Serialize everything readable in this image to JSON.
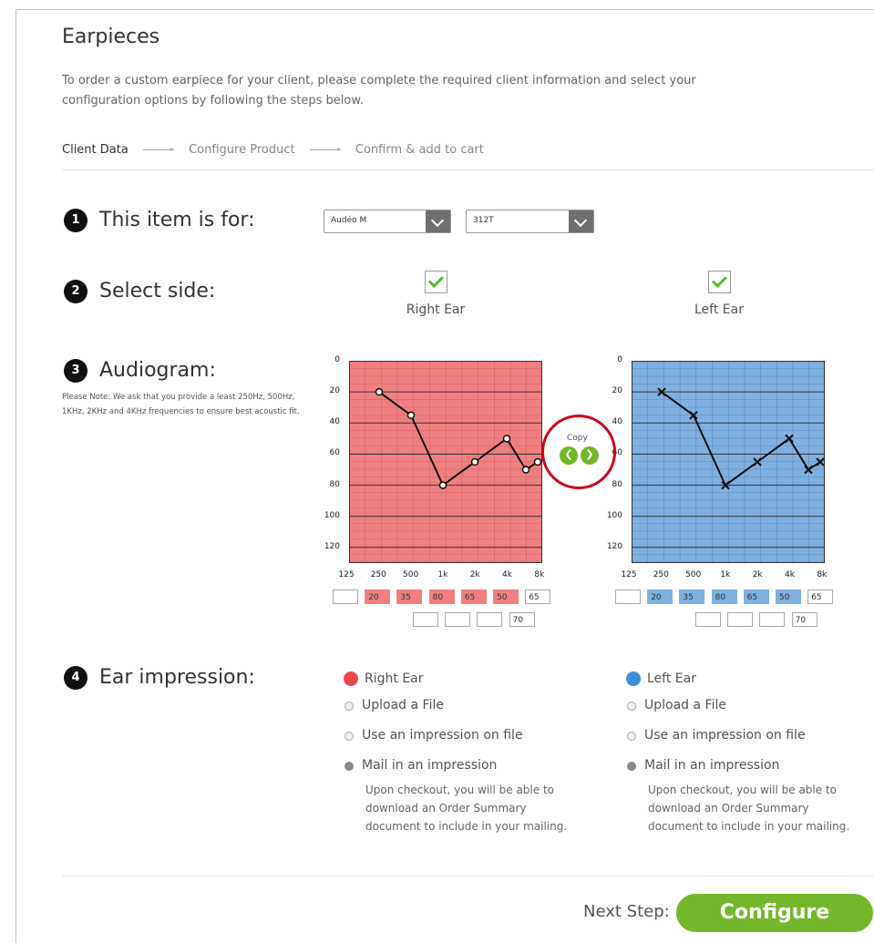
{
  "page": {
    "title": "Earpieces",
    "intro": "To order a custom earpiece for your client, please complete the required client information and select your configuration options by following the steps below."
  },
  "steps": [
    "Client Data",
    "Configure Product",
    "Confirm & add to cart"
  ],
  "section1": {
    "number": "1",
    "label": "This item is for:",
    "dropdown1": "Audéo M",
    "dropdown2": "312T"
  },
  "section2": {
    "number": "2",
    "label": "Select side:",
    "right_label": "Right Ear",
    "left_label": "Left Ear",
    "right_checked": true,
    "left_checked": true
  },
  "section3": {
    "number": "3",
    "label": "Audiogram:",
    "note": "Please Note: We ask that you provide a least 250Hz, 500Hz, 1KHz, 2KHz and 4KHz frequencies to ensure best acoustic fit.",
    "copy_label": "Copy",
    "copy_left_icon": "chevron-left-icon",
    "copy_right_icon": "chevron-right-icon"
  },
  "chart_data": [
    {
      "type": "line",
      "ear": "Right Ear",
      "color": "#f08080",
      "marker": "circle",
      "x": [
        "125",
        "250",
        "500",
        "1k",
        "2k",
        "4k",
        "8k"
      ],
      "y_ticks": [
        "0",
        "20",
        "40",
        "60",
        "80",
        "100",
        "120"
      ],
      "ylim": [
        0,
        130
      ],
      "points": [
        {
          "x": "250",
          "y": 20
        },
        {
          "x": "500",
          "y": 35
        },
        {
          "x": "1k",
          "y": 80
        },
        {
          "x": "2k",
          "y": 65
        },
        {
          "x": "4k",
          "y": 50
        },
        {
          "x": "6k",
          "y": 70
        },
        {
          "x": "8k",
          "y": 65
        }
      ],
      "main_inputs": [
        "",
        "20",
        "35",
        "80",
        "65",
        "50",
        "65"
      ],
      "mid_inputs": [
        "",
        "",
        "",
        "70"
      ]
    },
    {
      "type": "line",
      "ear": "Left Ear",
      "color": "#7fb0e0",
      "marker": "x",
      "x": [
        "125",
        "250",
        "500",
        "1k",
        "2k",
        "4k",
        "8k"
      ],
      "y_ticks": [
        "0",
        "20",
        "40",
        "60",
        "80",
        "100",
        "120"
      ],
      "ylim": [
        0,
        130
      ],
      "points": [
        {
          "x": "250",
          "y": 20
        },
        {
          "x": "500",
          "y": 35
        },
        {
          "x": "1k",
          "y": 80
        },
        {
          "x": "2k",
          "y": 65
        },
        {
          "x": "4k",
          "y": 50
        },
        {
          "x": "6k",
          "y": 70
        },
        {
          "x": "8k",
          "y": 65
        }
      ],
      "main_inputs": [
        "",
        "20",
        "35",
        "80",
        "65",
        "50",
        "65"
      ],
      "mid_inputs": [
        "",
        "",
        "",
        "70"
      ]
    }
  ],
  "section4": {
    "number": "4",
    "label": "Ear impression:",
    "right": {
      "title": "Right Ear",
      "dot_color": "#e8484d",
      "options": [
        "Upload a File",
        "Use an impression on file",
        "Mail in an impression"
      ],
      "selected": "Mail in an impression",
      "note": "Upon checkout, you will be able to download an Order Summary document to include in your mailing."
    },
    "left": {
      "title": "Left Ear",
      "dot_color": "#3b8fd9",
      "options": [
        "Upload a File",
        "Use an impression on file",
        "Mail in an impression"
      ],
      "selected": "Mail in an impression",
      "note": "Upon checkout, you will be able to download an Order Summary document to include in your mailing."
    }
  },
  "footer": {
    "next_label": "Next Step:",
    "button_label": "Configure"
  },
  "colors": {
    "accent": "#73b72b",
    "highlight_circle": "#d0021b"
  }
}
